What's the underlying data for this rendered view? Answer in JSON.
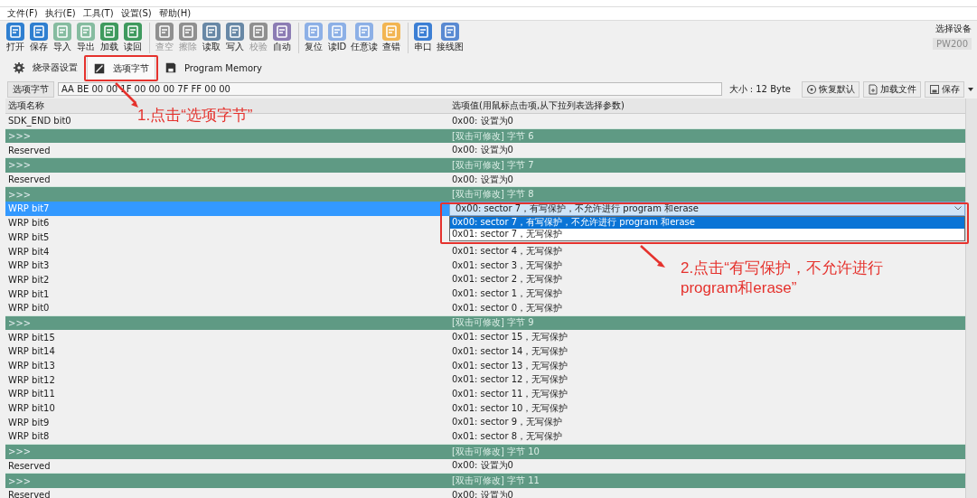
{
  "menu": [
    {
      "label": "文件(F)"
    },
    {
      "label": "执行(E)"
    },
    {
      "label": "工具(T)"
    },
    {
      "label": "设置(S)"
    },
    {
      "label": "帮助(H)"
    }
  ],
  "toolbar": [
    {
      "label": "打开",
      "color": "#2f7fd0",
      "disabled": false,
      "separator_before": false
    },
    {
      "label": "保存",
      "color": "#2f7fd0",
      "disabled": false,
      "separator_before": false
    },
    {
      "label": "导入",
      "color": "#86bca0",
      "disabled": false,
      "separator_before": false
    },
    {
      "label": "导出",
      "color": "#86bca0",
      "disabled": false,
      "separator_before": false
    },
    {
      "label": "加载",
      "color": "#3f9a5e",
      "disabled": false,
      "separator_before": false
    },
    {
      "label": "读回",
      "color": "#3f9a5e",
      "disabled": false,
      "separator_before": false
    },
    {
      "label": "查空",
      "color": "#909090",
      "disabled": true,
      "separator_before": true
    },
    {
      "label": "擦除",
      "color": "#909090",
      "disabled": true,
      "separator_before": false
    },
    {
      "label": "读取",
      "color": "#6888a6",
      "disabled": false,
      "separator_before": false
    },
    {
      "label": "写入",
      "color": "#6888a6",
      "disabled": false,
      "separator_before": false
    },
    {
      "label": "校验",
      "color": "#909090",
      "disabled": true,
      "separator_before": false
    },
    {
      "label": "自动",
      "color": "#8c7cb4",
      "disabled": false,
      "separator_before": false
    },
    {
      "label": "复位",
      "color": "#8db0e6",
      "disabled": false,
      "separator_before": true
    },
    {
      "label": "读ID",
      "color": "#8db0e6",
      "disabled": false,
      "separator_before": false
    },
    {
      "label": "任意读",
      "color": "#8db0e6",
      "disabled": false,
      "separator_before": false
    },
    {
      "label": "查错",
      "color": "#f2b552",
      "disabled": false,
      "separator_before": false
    },
    {
      "label": "串口",
      "color": "#3c7fd4",
      "disabled": false,
      "separator_before": true
    },
    {
      "label": "接线图",
      "color": "#5a8ad2",
      "disabled": false,
      "separator_before": false
    }
  ],
  "device": {
    "label": "选择设备",
    "value": "PW200",
    "disabled": true
  },
  "tabs": [
    {
      "label": "烧录器设置",
      "selected": false
    },
    {
      "label": "选项字节",
      "selected": true
    },
    {
      "label": "Program Memory",
      "selected": false
    }
  ],
  "option_bar": {
    "label": "选项字节",
    "value": "AA BE 00 00 1F 00 00 00 7F FF 00 00",
    "size": "大小 : 12 Byte",
    "buttons": [
      {
        "label": "恢复默认"
      },
      {
        "label": "加载文件"
      },
      {
        "label": "保存"
      }
    ]
  },
  "table": {
    "columns": [
      "选项名称",
      "选项值(用鼠标点击项,从下拉列表选择参数)"
    ],
    "rows": [
      {
        "kind": "item",
        "name": "SDK_END bit0",
        "value": "0x00: 设置为0",
        "selected": false
      },
      {
        "kind": "group",
        "name": ">>>",
        "value": "[双击可修改] 字节 6",
        "selected": false
      },
      {
        "kind": "item",
        "name": "Reserved",
        "value": "0x00: 设置为0",
        "selected": false
      },
      {
        "kind": "group",
        "name": ">>>",
        "value": "[双击可修改] 字节 7",
        "selected": false
      },
      {
        "kind": "item",
        "name": "Reserved",
        "value": "0x00: 设置为0",
        "selected": false
      },
      {
        "kind": "group",
        "name": ">>>",
        "value": "[双击可修改] 字节 8",
        "selected": false
      },
      {
        "kind": "item",
        "name": "WRP bit7",
        "selected": true,
        "dropdown": {
          "value": "0x00: sector 7，有写保护，不允许进行 program 和erase",
          "options": [
            {
              "label": "0x00: sector 7，有写保护，不允许进行 program 和erase",
              "selected": true
            },
            {
              "label": "0x01: sector 7，无写保护",
              "selected": false
            }
          ]
        }
      },
      {
        "kind": "item",
        "name": "WRP bit6",
        "selected": false
      },
      {
        "kind": "item",
        "name": "WRP bit5",
        "selected": false
      },
      {
        "kind": "item",
        "name": "WRP bit4",
        "value": "0x01: sector 4，无写保护",
        "selected": false
      },
      {
        "kind": "item",
        "name": "WRP bit3",
        "value": "0x01: sector 3，无写保护",
        "selected": false
      },
      {
        "kind": "item",
        "name": "WRP bit2",
        "value": "0x01: sector 2，无写保护",
        "selected": false
      },
      {
        "kind": "item",
        "name": "WRP bit1",
        "value": "0x01: sector 1，无写保护",
        "selected": false
      },
      {
        "kind": "item",
        "name": "WRP bit0",
        "value": "0x01: sector 0，无写保护",
        "selected": false
      },
      {
        "kind": "group",
        "name": ">>>",
        "value": "[双击可修改] 字节 9",
        "selected": false
      },
      {
        "kind": "item",
        "name": "WRP bit15",
        "value": "0x01: sector 15，无写保护",
        "selected": false
      },
      {
        "kind": "item",
        "name": "WRP bit14",
        "value": "0x01: sector 14，无写保护",
        "selected": false
      },
      {
        "kind": "item",
        "name": "WRP bit13",
        "value": "0x01: sector 13，无写保护",
        "selected": false
      },
      {
        "kind": "item",
        "name": "WRP bit12",
        "value": "0x01: sector 12，无写保护",
        "selected": false
      },
      {
        "kind": "item",
        "name": "WRP bit11",
        "value": "0x01: sector 11，无写保护",
        "selected": false
      },
      {
        "kind": "item",
        "name": "WRP bit10",
        "value": "0x01: sector 10，无写保护",
        "selected": false
      },
      {
        "kind": "item",
        "name": "WRP bit9",
        "value": "0x01: sector 9，无写保护",
        "selected": false
      },
      {
        "kind": "item",
        "name": "WRP bit8",
        "value": "0x01: sector 8，无写保护",
        "selected": false
      },
      {
        "kind": "group",
        "name": ">>>",
        "value": "[双击可修改] 字节 10",
        "selected": false
      },
      {
        "kind": "item",
        "name": "Reserved",
        "value": "0x00: 设置为0",
        "selected": false
      },
      {
        "kind": "group",
        "name": ">>>",
        "value": "[双击可修改] 字节 11",
        "selected": false
      },
      {
        "kind": "item",
        "name": "Reserved",
        "value": "0x00: 设置为0",
        "selected": false
      }
    ]
  },
  "annotations": [
    {
      "text": "1.点击“选项字节”"
    },
    {
      "text": "2.点击“有写保护，不允许进行program和erase”"
    }
  ]
}
